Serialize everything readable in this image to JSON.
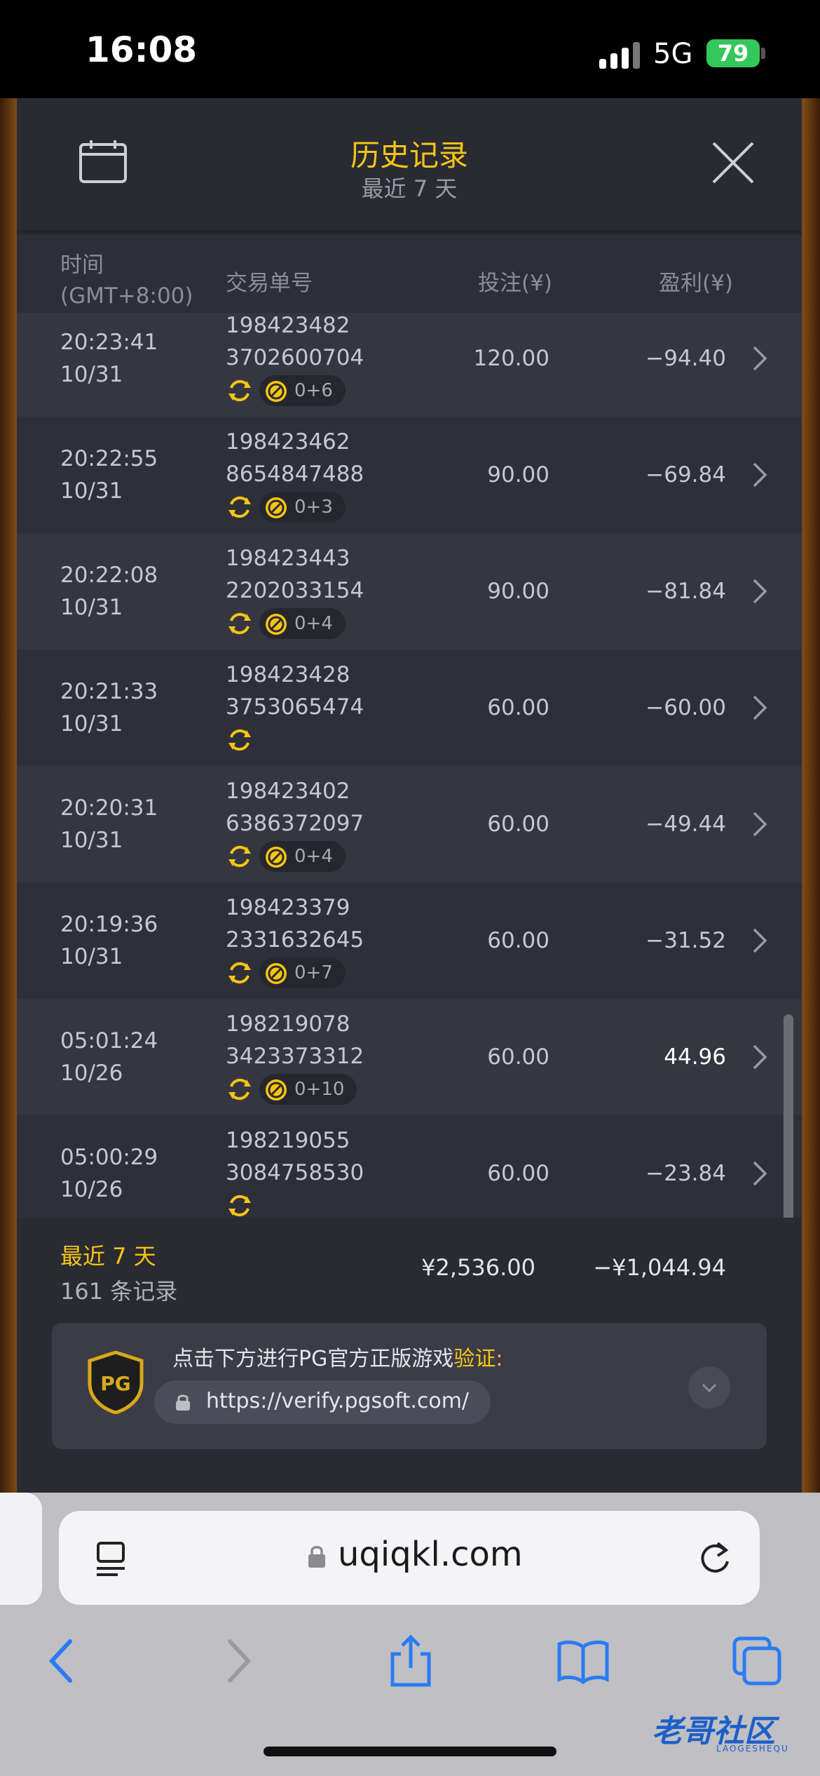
{
  "status_bar": {
    "time": "16:08",
    "network": "5G",
    "battery": "79"
  },
  "dialog": {
    "title": "历史记录",
    "subtitle": "最近 7 天",
    "columns": {
      "time": "时间",
      "timezone": "(GMT+8:00)",
      "txid": "交易单号",
      "bet": "投注(¥)",
      "profit": "盈利(¥)"
    },
    "rows": [
      {
        "time": "20:23:41",
        "date": "10/31",
        "txid1": "198423482",
        "txid2": "3702600704",
        "badge": "0+6",
        "bet": "120.00",
        "profit": "−94.40"
      },
      {
        "time": "20:22:55",
        "date": "10/31",
        "txid1": "198423462",
        "txid2": "8654847488",
        "badge": "0+3",
        "bet": "90.00",
        "profit": "−69.84"
      },
      {
        "time": "20:22:08",
        "date": "10/31",
        "txid1": "198423443",
        "txid2": "2202033154",
        "badge": "0+4",
        "bet": "90.00",
        "profit": "−81.84"
      },
      {
        "time": "20:21:33",
        "date": "10/31",
        "txid1": "198423428",
        "txid2": "3753065474",
        "badge": "",
        "bet": "60.00",
        "profit": "−60.00"
      },
      {
        "time": "20:20:31",
        "date": "10/31",
        "txid1": "198423402",
        "txid2": "6386372097",
        "badge": "0+4",
        "bet": "60.00",
        "profit": "−49.44"
      },
      {
        "time": "20:19:36",
        "date": "10/31",
        "txid1": "198423379",
        "txid2": "2331632645",
        "badge": "0+7",
        "bet": "60.00",
        "profit": "−31.52"
      },
      {
        "time": "05:01:24",
        "date": "10/26",
        "txid1": "198219078",
        "txid2": "3423373312",
        "badge": "0+10",
        "bet": "60.00",
        "profit": "44.96"
      },
      {
        "time": "05:00:29",
        "date": "10/26",
        "txid1": "198219055",
        "txid2": "3084758530",
        "badge": "",
        "bet": "60.00",
        "profit": "−23.84"
      }
    ],
    "summary": {
      "label": "最近 7 天",
      "count": "161 条记录",
      "total_bet": "¥2,536.00",
      "total_profit": "−¥1,044.94"
    },
    "verify": {
      "text": "点击下方进行PG官方正版游戏",
      "highlight": "验证:",
      "logo": "PG",
      "url": "https://verify.pgsoft.com/"
    }
  },
  "safari": {
    "domain": "uqiqkl.com"
  },
  "watermark": {
    "main": "老哥社区",
    "sub": "LAOGESHEQU"
  }
}
